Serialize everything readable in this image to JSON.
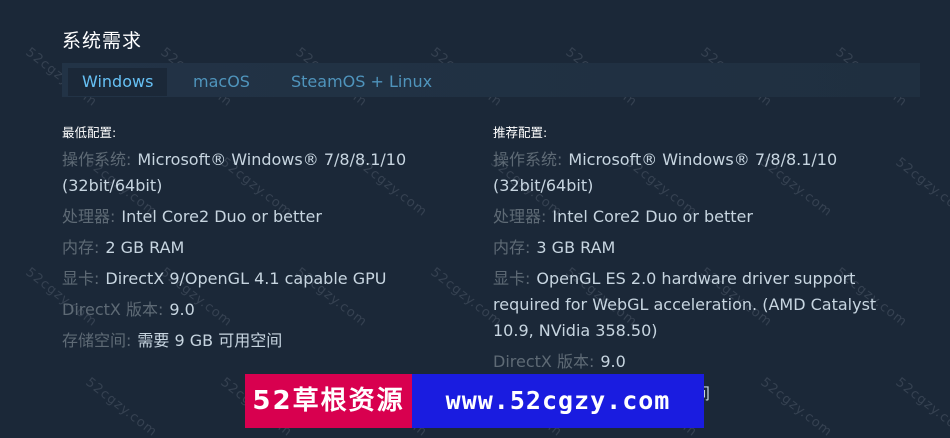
{
  "section": {
    "title": "系统需求"
  },
  "tabs": [
    {
      "label": "Windows",
      "active": true
    },
    {
      "label": "macOS",
      "active": false
    },
    {
      "label": "SteamOS + Linux",
      "active": false
    }
  ],
  "minimum": {
    "title": "最低配置:",
    "rows": [
      {
        "label": "操作系统:",
        "value": "Microsoft® Windows® 7/8/8.1/10 (32bit/64bit)"
      },
      {
        "label": "处理器:",
        "value": "Intel Core2 Duo or better"
      },
      {
        "label": "内存:",
        "value": "2 GB RAM"
      },
      {
        "label": "显卡:",
        "value": "DirectX 9/OpenGL 4.1 capable GPU"
      },
      {
        "label": "DirectX 版本:",
        "value": "9.0"
      },
      {
        "label": "存储空间:",
        "value": "需要 9 GB 可用空间"
      }
    ]
  },
  "recommended": {
    "title": "推荐配置:",
    "rows": [
      {
        "label": "操作系统:",
        "value": "Microsoft® Windows® 7/8/8.1/10 (32bit/64bit)"
      },
      {
        "label": "处理器:",
        "value": "Intel Core2 Duo or better"
      },
      {
        "label": "内存:",
        "value": "3 GB RAM"
      },
      {
        "label": "显卡:",
        "value": "OpenGL ES 2.0 hardware driver support required for WebGL acceleration. (AMD Catalyst 10.9, NVidia 358.50)"
      },
      {
        "label": "DirectX 版本:",
        "value": "9.0"
      }
    ],
    "partial_text": "间"
  },
  "watermark": {
    "text": "52cgzy.com"
  },
  "banner": {
    "left_text": "52草根资源",
    "right_text": "www.52cgzy.com"
  },
  "colors": {
    "background": "#1b2838",
    "accent": "#66c0f4",
    "banner_red": "#d8004f",
    "banner_blue": "#1a1ce0"
  }
}
